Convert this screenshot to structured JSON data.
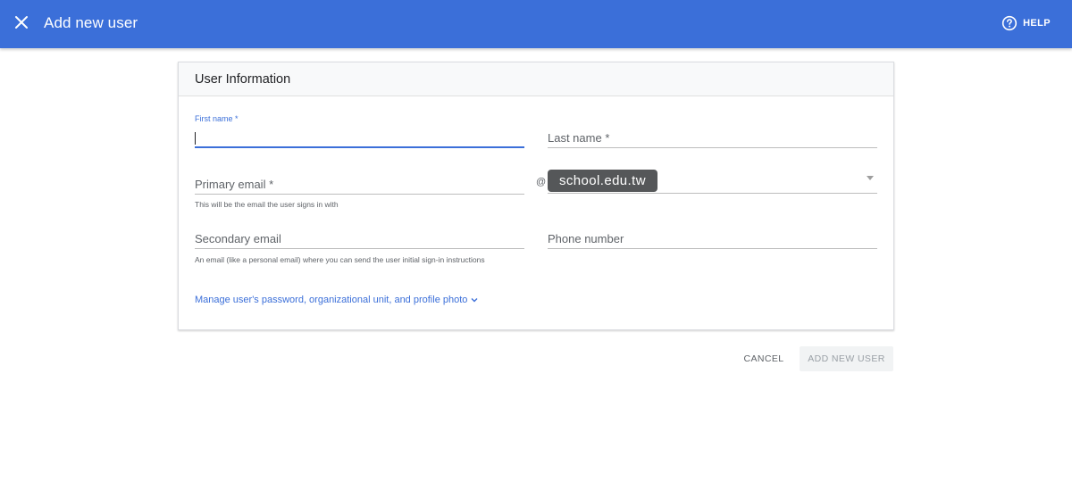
{
  "header": {
    "title": "Add new user",
    "close_icon": "close-icon",
    "help_label": "HELP",
    "help_icon": "help-circle-icon",
    "background_color": "#3b6fd9"
  },
  "card": {
    "title": "User Information"
  },
  "form": {
    "first_name": {
      "label": "First name *",
      "value": ""
    },
    "last_name": {
      "placeholder": "Last name *",
      "value": ""
    },
    "primary_email": {
      "placeholder": "Primary email *",
      "value": "",
      "helper": "This will be the email the user signs in with"
    },
    "at_symbol": "@",
    "domain": {
      "selected": "school.edu.tw"
    },
    "secondary_email": {
      "placeholder": "Secondary email",
      "value": "",
      "helper": "An email (like a personal email) where you can send the user initial sign-in instructions"
    },
    "phone_number": {
      "placeholder": "Phone number",
      "value": ""
    },
    "manage_link": "Manage user's password, organizational unit, and profile photo"
  },
  "actions": {
    "cancel_label": "CANCEL",
    "add_label": "ADD NEW USER"
  }
}
